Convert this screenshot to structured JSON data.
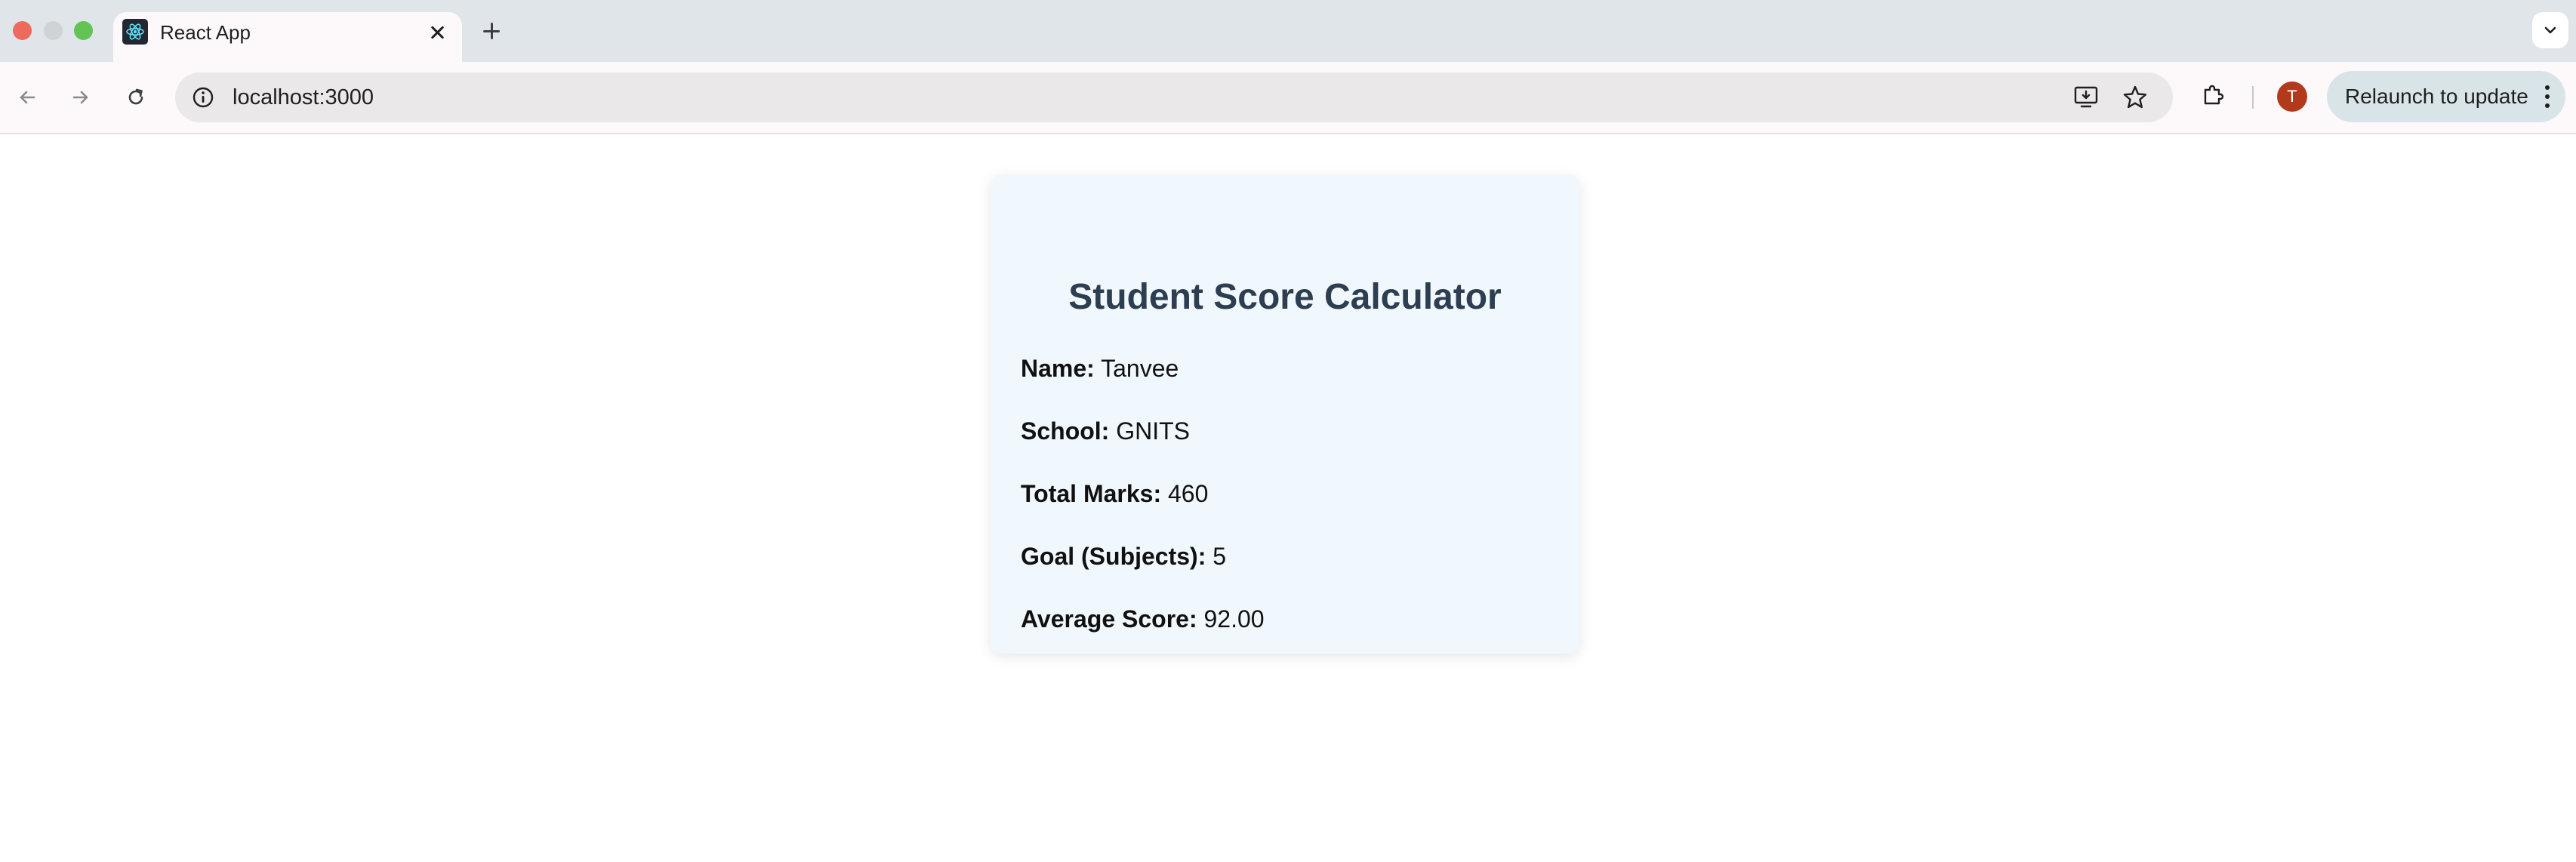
{
  "browser": {
    "tab_title": "React App",
    "url": "localhost:3000",
    "avatar_initial": "T",
    "relaunch_label": "Relaunch to update"
  },
  "app": {
    "title": "Student Score Calculator",
    "fields": [
      {
        "label": "Name:",
        "value": "Tanvee"
      },
      {
        "label": "School:",
        "value": "GNITS"
      },
      {
        "label": "Total Marks:",
        "value": "460"
      },
      {
        "label": "Goal (Subjects):",
        "value": "5"
      },
      {
        "label": "Average Score:",
        "value": "92.00"
      }
    ]
  },
  "colors": {
    "card_background": "#f0f7fd",
    "title_color": "#2c3e50",
    "avatar_color": "#b3391c"
  }
}
